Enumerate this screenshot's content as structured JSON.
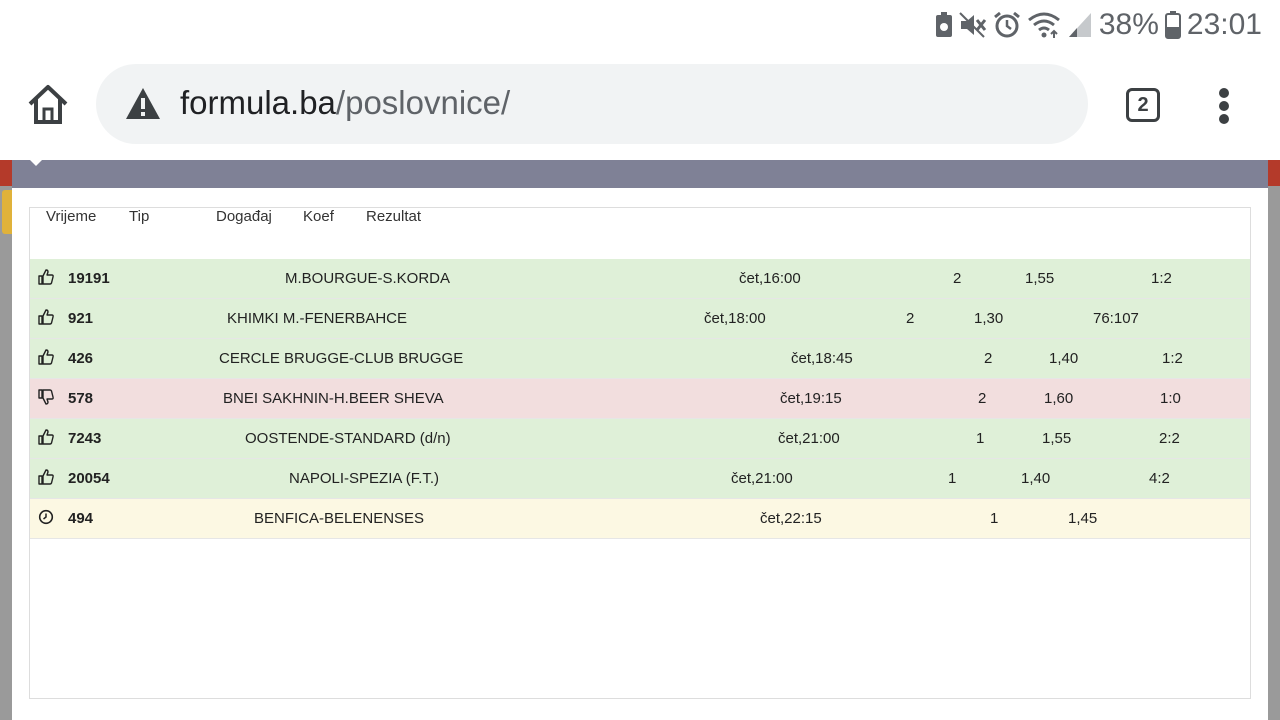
{
  "status_bar": {
    "battery_percent": "38%",
    "time": "23:01",
    "icons": [
      "nfc-icon",
      "mute-icon",
      "alarm-icon",
      "wifi-icon",
      "cellular-signal-icon",
      "battery-icon"
    ]
  },
  "browser": {
    "url_host": "formula.ba",
    "url_path": "/poslovnice/",
    "tab_count": "2",
    "icons": [
      "home-icon",
      "not-secure-warning-icon",
      "overflow-menu-icon"
    ]
  },
  "table": {
    "headers": {
      "vrijeme": "Vrijeme",
      "tip": "Tip",
      "dogadjaj": "Događaj",
      "koef": "Koef",
      "rezultat": "Rezultat"
    },
    "rows": [
      {
        "status": "win",
        "icon": "thumbs-up-icon",
        "id": "19191",
        "event": "M.BOURGUE-S.KORDA",
        "time": "čet,16:00",
        "tip": "2",
        "odds": "1,55",
        "result": "1:2"
      },
      {
        "status": "win",
        "icon": "thumbs-up-icon",
        "id": "921",
        "event": "KHIMKI M.-FENERBAHCE",
        "time": "čet,18:00",
        "tip": "2",
        "odds": "1,30",
        "result": "76:107"
      },
      {
        "status": "win",
        "icon": "thumbs-up-icon",
        "id": "426",
        "event": "CERCLE BRUGGE-CLUB BRUGGE",
        "time": "čet,18:45",
        "tip": "2",
        "odds": "1,40",
        "result": "1:2"
      },
      {
        "status": "loss",
        "icon": "thumbs-down-icon",
        "id": "578",
        "event": "BNEI SAKHNIN-H.BEER SHEVA",
        "time": "čet,19:15",
        "tip": "2",
        "odds": "1,60",
        "result": "1:0"
      },
      {
        "status": "win",
        "icon": "thumbs-up-icon",
        "id": "7243",
        "event": "OOSTENDE-STANDARD (d/n)",
        "time": "čet,21:00",
        "tip": "1",
        "odds": "1,55",
        "result": "2:2"
      },
      {
        "status": "win",
        "icon": "thumbs-up-icon",
        "id": "20054",
        "event": "NAPOLI-SPEZIA (F.T.)",
        "time": "čet,21:00",
        "tip": "1",
        "odds": "1,40",
        "result": "4:2"
      },
      {
        "status": "pending",
        "icon": "clock-icon",
        "id": "494",
        "event": "BENFICA-BELENENSES",
        "time": "čet,22:15",
        "tip": "1",
        "odds": "1,45",
        "result": ""
      }
    ]
  },
  "colors": {
    "win_row": "#dff0d8",
    "loss_row": "#f2dede",
    "pending_row": "#fcf8e3",
    "modal_header": "#7f8196"
  }
}
